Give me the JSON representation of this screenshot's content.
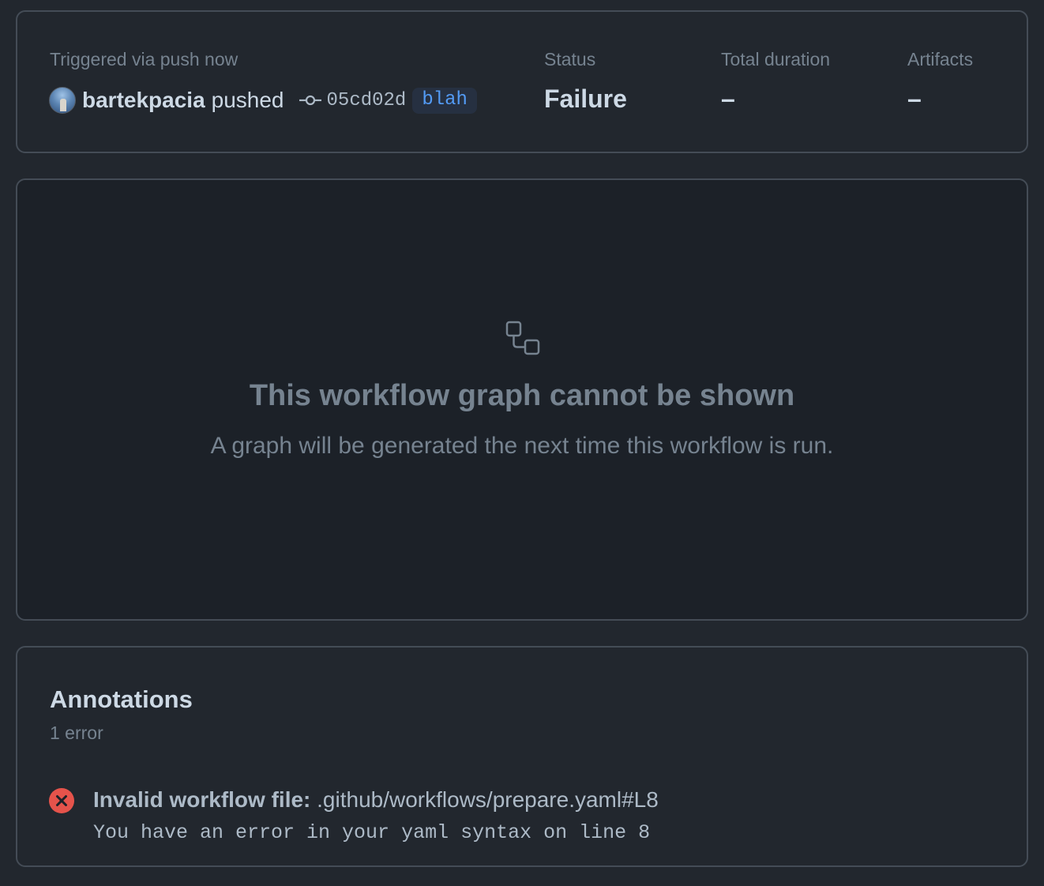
{
  "summary": {
    "trigger_label": "Triggered via push now",
    "actor": "bartekpacia",
    "action": "pushed",
    "commit_sha": "05cd02d",
    "branch": "blah",
    "status_label": "Status",
    "status_value": "Failure",
    "duration_label": "Total duration",
    "duration_value": "–",
    "artifacts_label": "Artifacts",
    "artifacts_value": "–"
  },
  "graph": {
    "icon": "workflow-icon",
    "title": "This workflow graph cannot be shown",
    "subtitle": "A graph will be generated the next time this workflow is run."
  },
  "annotations": {
    "title": "Annotations",
    "count": "1 error",
    "items": [
      {
        "icon": "x-circle-fill-icon",
        "label": "Invalid workflow file:",
        "path": " .github/workflows/prepare.yaml#L8",
        "message": "You have an error in your yaml syntax on line 8"
      }
    ]
  },
  "colors": {
    "background": "#22272e",
    "graph_background": "#1c2128",
    "border": "#444c56",
    "error": "#e5534b",
    "branch_accent": "#539bf5"
  }
}
